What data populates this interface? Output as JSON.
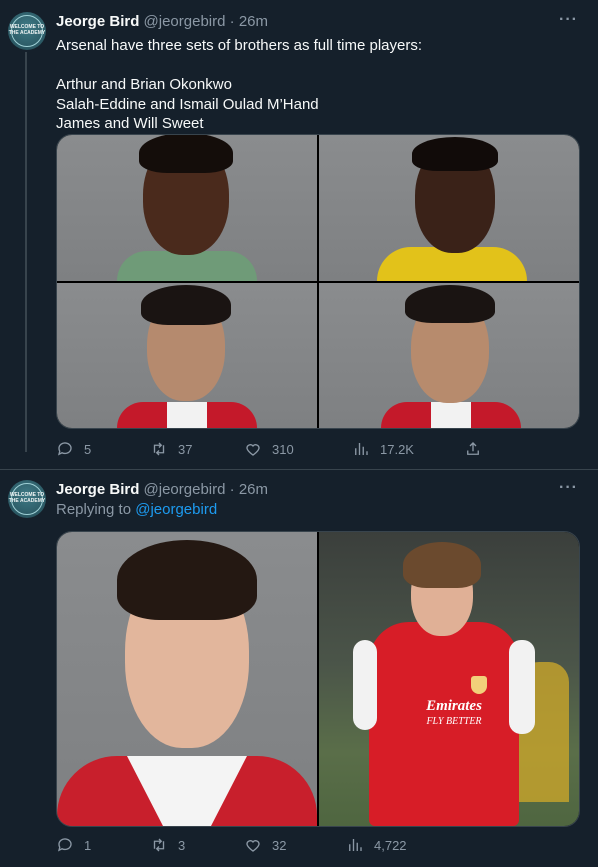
{
  "tweet1": {
    "author_name": "Jeorge Bird",
    "author_handle": "@jeorgebird",
    "dot": "·",
    "time": "26m",
    "avatar_text": "WELCOME TO THE ACADEMY",
    "text": "Arsenal have three sets of brothers as full time players:\n\nArthur and Brian Okonkwo\nSalah-Eddine and Ismail Oulad M’Hand\nJames and Will Sweet",
    "replies": "5",
    "retweets": "37",
    "likes": "310",
    "views": "17.2K"
  },
  "tweet2": {
    "author_name": "Jeorge Bird",
    "author_handle": "@jeorgebird",
    "dot": "·",
    "time": "26m",
    "avatar_text": "WELCOME TO THE ACADEMY",
    "replying_prefix": "Replying to",
    "replying_to": "@jeorgebird",
    "shirt_text_1": "Emirates",
    "shirt_text_2": "FLY BETTER",
    "replies": "1",
    "retweets": "3",
    "likes": "32",
    "views": "4,722"
  },
  "icons": {
    "more": "more-horizontal-icon",
    "reply": "reply-icon",
    "retweet": "retweet-icon",
    "like": "heart-icon",
    "views": "views-chart-icon",
    "share": "share-icon"
  },
  "colors": {
    "background": "#15202b",
    "secondary_text": "#8b98a5",
    "link": "#1d9bf0",
    "border": "#38444d",
    "arsenal_red": "#db0007"
  }
}
